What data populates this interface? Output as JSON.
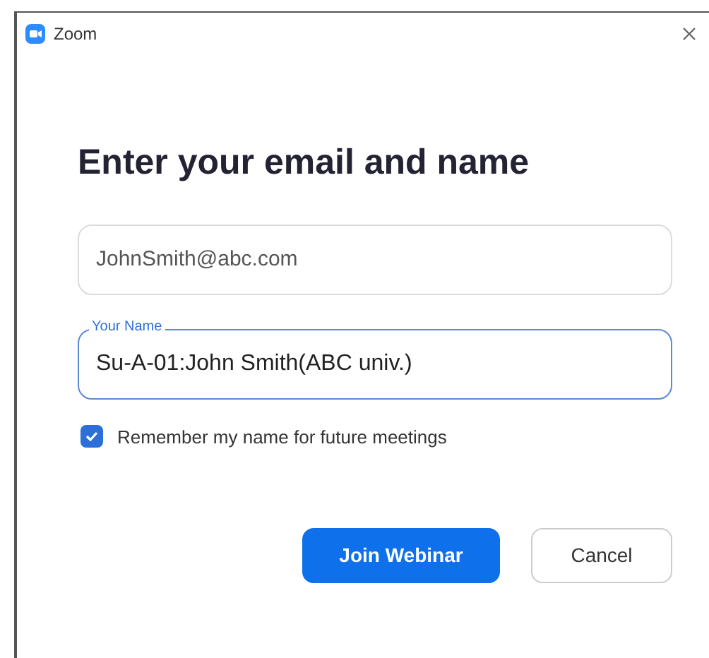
{
  "window": {
    "title": "Zoom"
  },
  "heading": "Enter your email and name",
  "email_field": {
    "value": "JohnSmith@abc.com",
    "focused": false
  },
  "name_field": {
    "label": "Your Name",
    "value": "Su-A-01:John Smith(ABC univ.)",
    "focused": true
  },
  "remember": {
    "label": "Remember my name for future meetings",
    "checked": true
  },
  "buttons": [
    {
      "label": "Join Webinar",
      "kind": "primary"
    },
    {
      "label": "Cancel",
      "kind": "secondary"
    }
  ]
}
